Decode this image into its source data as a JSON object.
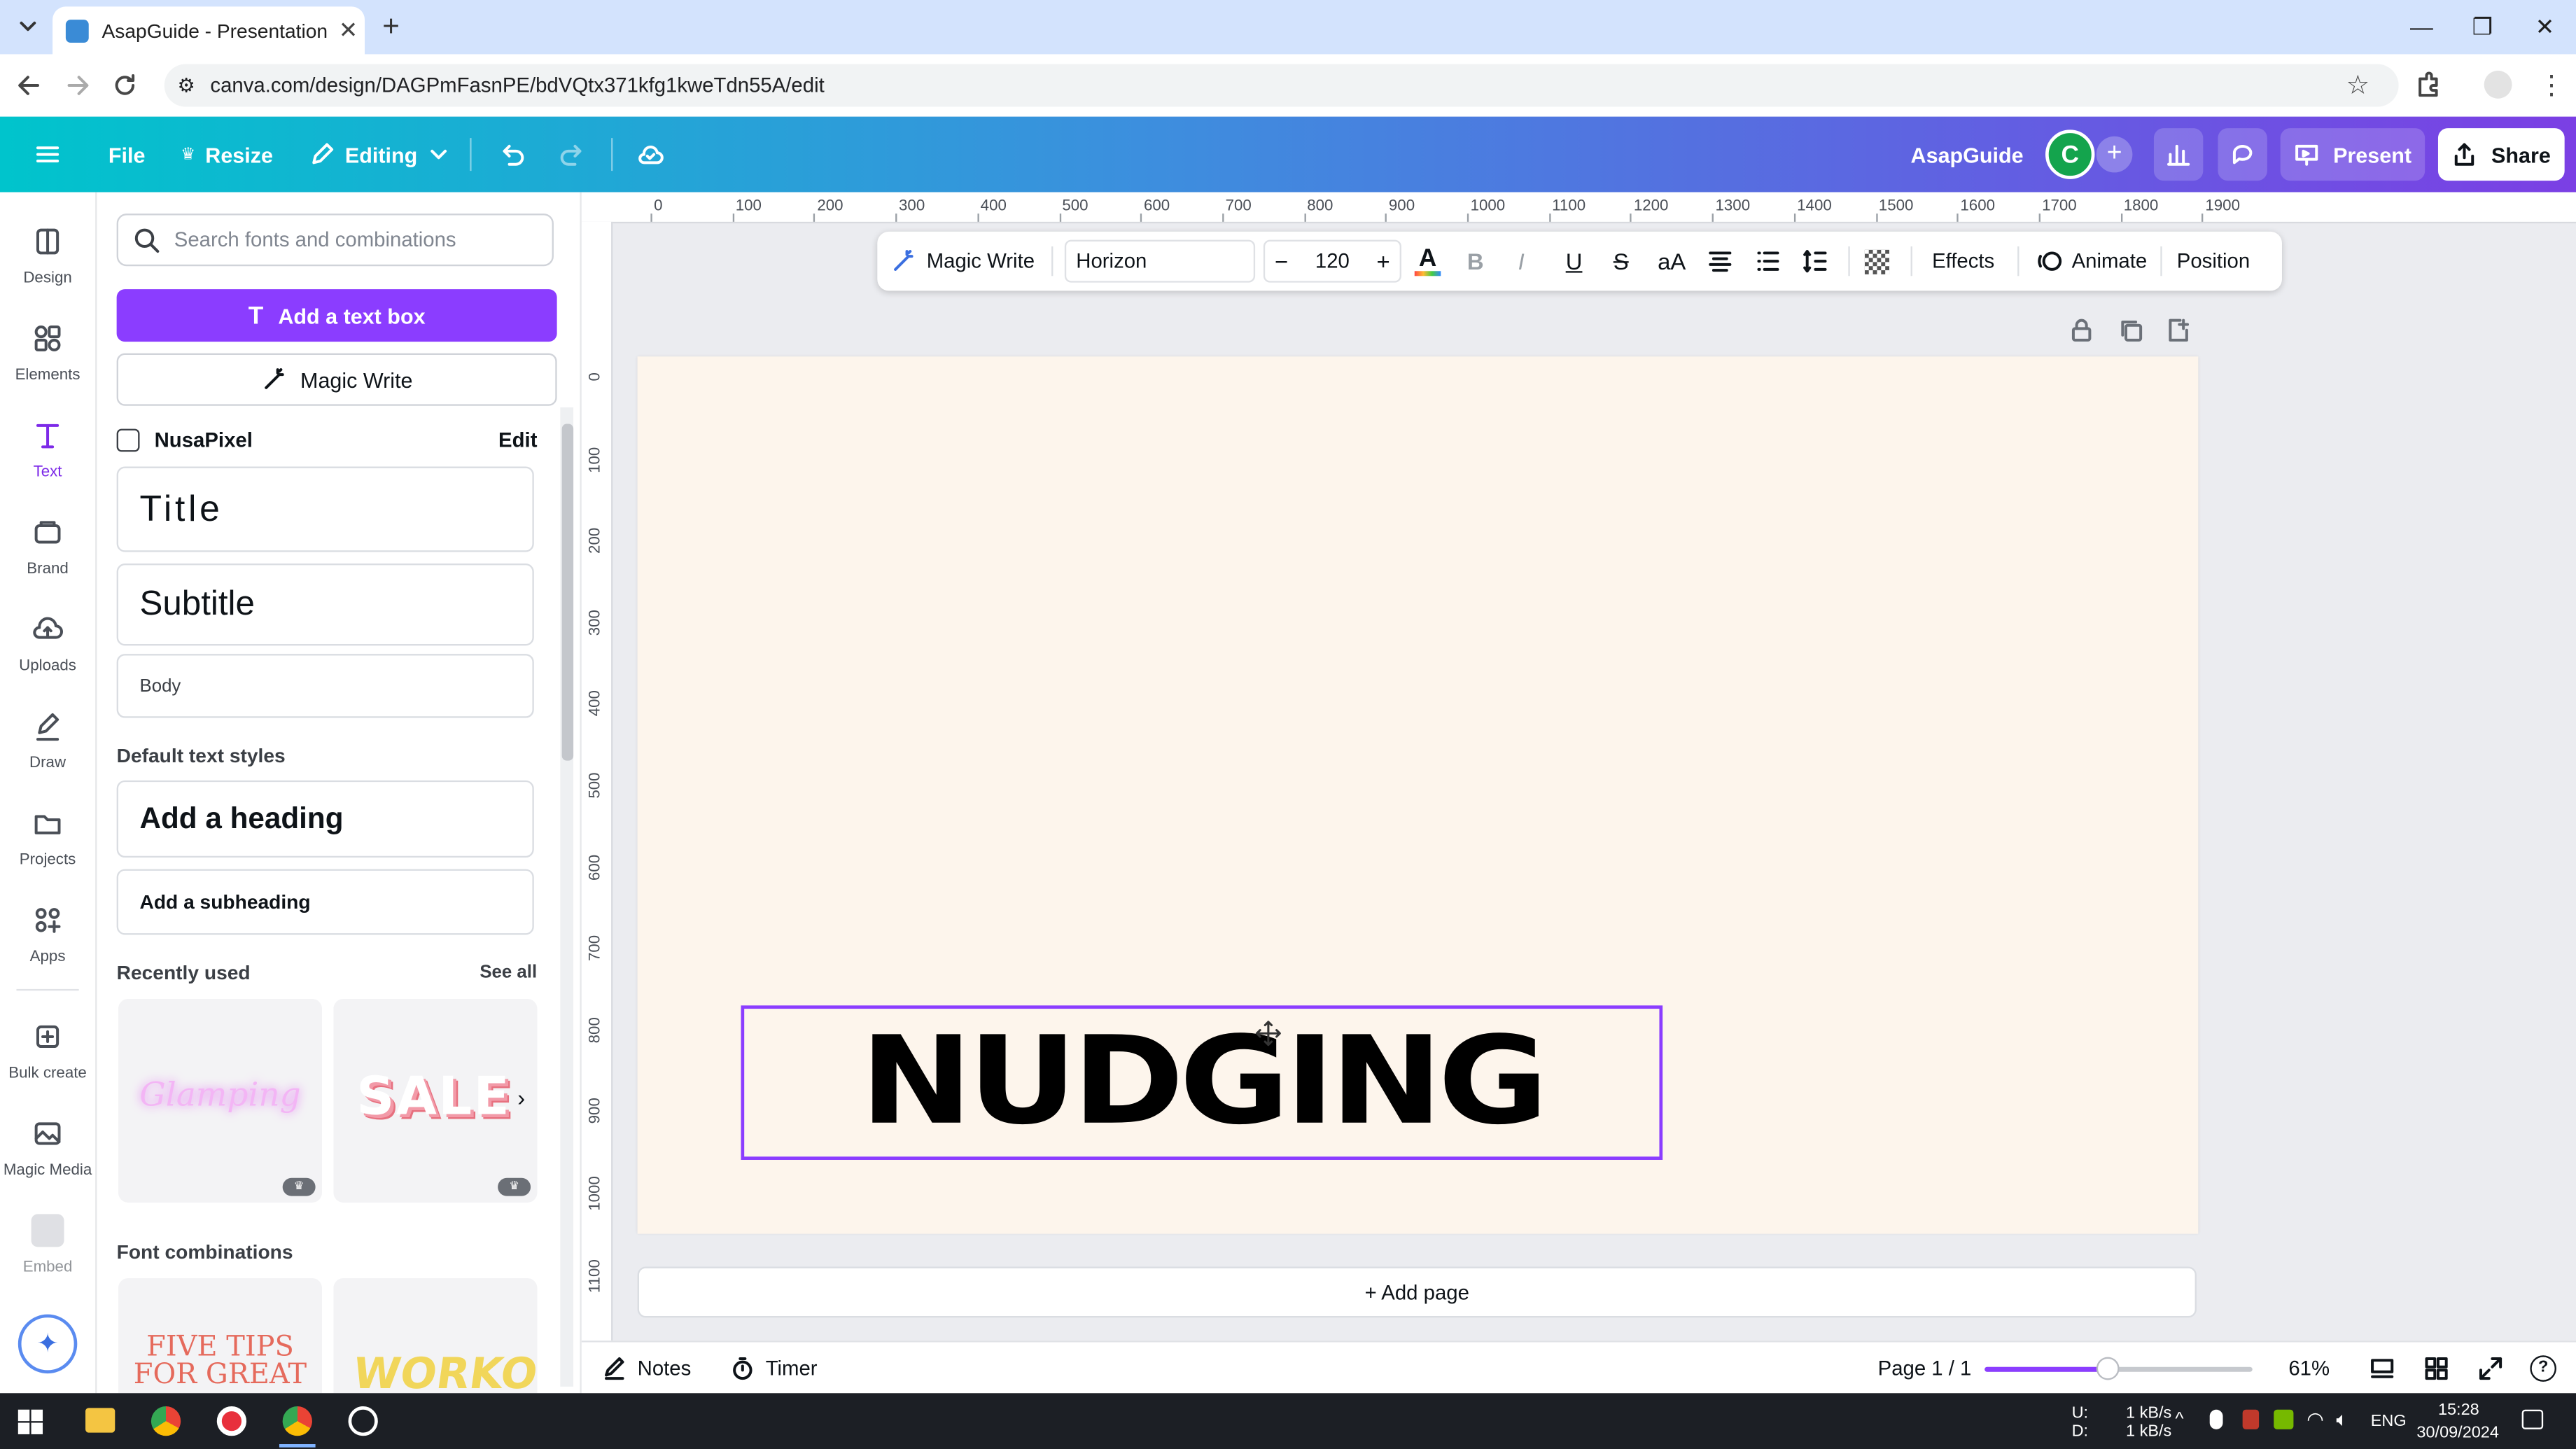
{
  "browser": {
    "tab_title": "AsapGuide - Presentation",
    "url": "canva.com/design/DAGPmFasnPE/bdVQtx371kfg1kweTdn55A/edit"
  },
  "header": {
    "file": "File",
    "resize": "Resize",
    "editing": "Editing",
    "team": "AsapGuide",
    "avatar_letter": "C",
    "present": "Present",
    "share": "Share"
  },
  "rail": {
    "items": [
      "Design",
      "Elements",
      "Text",
      "Brand",
      "Uploads",
      "Draw",
      "Projects",
      "Apps",
      "Bulk create",
      "Magic Media",
      "Embed"
    ]
  },
  "panel": {
    "search_placeholder": "Search fonts and combinations",
    "add_text_box": "Add a text box",
    "magic_write": "Magic Write",
    "brand_kit": "NusaPixel",
    "brand_edit": "Edit",
    "brand_styles": {
      "title": "Title",
      "subtitle": "Subtitle",
      "body": "Body"
    },
    "default_styles_title": "Default text styles",
    "add_heading": "Add a heading",
    "add_subheading": "Add a subheading",
    "recently_used": "Recently used",
    "see_all": "See all",
    "recent_thumbs": [
      "Glamping",
      "SALE"
    ],
    "font_combinations": "Font combinations",
    "combo_thumbs": [
      "FIVE TIPS FOR GREAT",
      "WORKOUT"
    ]
  },
  "rulers": {
    "top": [
      "0",
      "100",
      "200",
      "300",
      "400",
      "500",
      "600",
      "700",
      "800",
      "900",
      "1000",
      "1100",
      "1200",
      "1300",
      "1400",
      "1500",
      "1600",
      "1700",
      "1800",
      "1900"
    ],
    "left": [
      "0",
      "100",
      "200",
      "300",
      "400",
      "500",
      "600",
      "700",
      "800",
      "900",
      "1000",
      "1100"
    ]
  },
  "toolbar": {
    "magic_write": "Magic Write",
    "font": "Horizon",
    "font_size": "120",
    "effects": "Effects",
    "animate": "Animate",
    "position": "Position"
  },
  "canvas": {
    "headline": "NUDGING",
    "add_page": "+ Add page",
    "background": "#fdf5ec",
    "selection_color": "#8b3dff"
  },
  "bottom": {
    "notes": "Notes",
    "timer": "Timer",
    "page": "Page 1 / 1",
    "zoom": "61%",
    "zoom_level": 0.46
  },
  "taskbar": {
    "net_up_label": "U:",
    "net_down_label": "D:",
    "net_up": "1 kB/s",
    "net_down": "1 kB/s",
    "lang": "ENG",
    "time": "15:28",
    "date": "30/09/2024"
  }
}
